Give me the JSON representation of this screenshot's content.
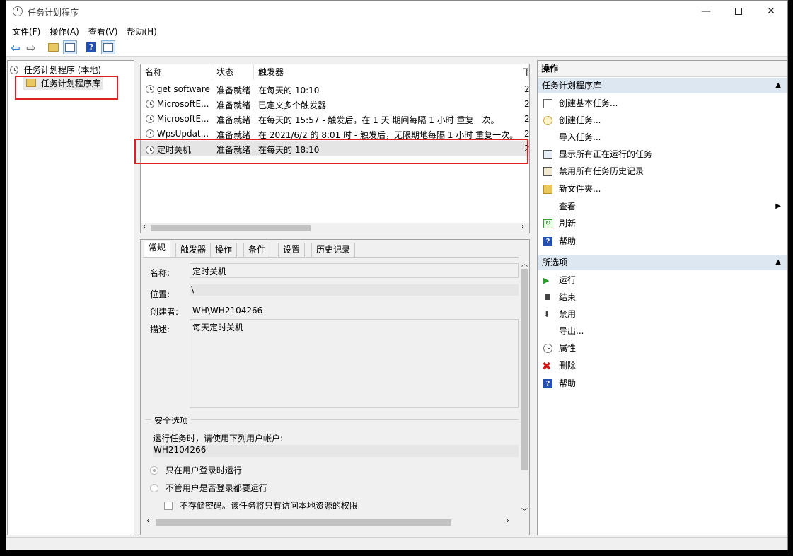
{
  "window": {
    "title": "任务计划程序"
  },
  "menu": [
    "文件(F)",
    "操作(A)",
    "查看(V)",
    "帮助(H)"
  ],
  "tree": {
    "root": "任务计划程序 (本地)",
    "child": "任务计划程序库"
  },
  "table": {
    "headers": [
      "名称",
      "状态",
      "触发器",
      "下"
    ],
    "rows": [
      {
        "name": "get software",
        "status": "准备就绪",
        "trigger": "在每天的 10:10",
        "next": "2"
      },
      {
        "name": "MicrosoftE...",
        "status": "准备就绪",
        "trigger": "已定义多个触发器",
        "next": "2"
      },
      {
        "name": "MicrosoftE...",
        "status": "准备就绪",
        "trigger": "在每天的 15:57 - 触发后，在 1 天 期间每隔 1 小时 重复一次。",
        "next": "2"
      },
      {
        "name": "WpsUpdat...",
        "status": "准备就绪",
        "trigger": "在 2021/6/2 的 8:01 时 - 触发后，无限期地每隔 1 小时 重复一次。",
        "next": "2"
      },
      {
        "name": "定时关机",
        "status": "准备就绪",
        "trigger": "在每天的 18:10",
        "next": "2"
      }
    ]
  },
  "tabs": [
    "常规",
    "触发器",
    "操作",
    "条件",
    "设置",
    "历史记录"
  ],
  "general": {
    "name_label": "名称:",
    "name_value": "定时关机",
    "location_label": "位置:",
    "location_value": "\\",
    "author_label": "创建者:",
    "author_value": "WH\\WH2104266",
    "desc_label": "描述:",
    "desc_value": "每天定时关机",
    "security_title": "安全选项",
    "run_as_label": "运行任务时，请使用下列用户帐户:",
    "run_as_value": "WH2104266",
    "radio1": "只在用户登录时运行",
    "radio2": "不管用户是否登录都要运行",
    "checkbox1": "不存储密码。该任务将只有访问本地资源的权限"
  },
  "actions": {
    "header": "操作",
    "section1": "任务计划程序库",
    "items1": [
      "创建基本任务...",
      "创建任务...",
      "导入任务...",
      "显示所有正在运行的任务",
      "禁用所有任务历史记录",
      "新文件夹...",
      "查看",
      "刷新",
      "帮助"
    ],
    "section2": "所选项",
    "items2": [
      "运行",
      "结束",
      "禁用",
      "导出...",
      "属性",
      "删除",
      "帮助"
    ]
  }
}
